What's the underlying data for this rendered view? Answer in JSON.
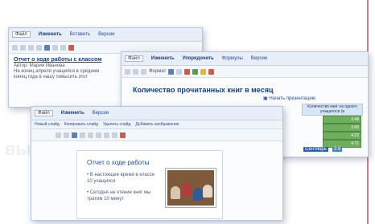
{
  "background_text": "вышенным в нашем с прошл и для моря",
  "doc_window": {
    "tabs": [
      "Файл",
      "Изменить",
      "Вставить",
      "Версии"
    ],
    "title": "Отчет о ходе работы с классом",
    "lines": [
      "Автор: Мария Иванова",
      "На конец апреля учащийся в среднем",
      "конец года в нашу повысить этот"
    ]
  },
  "spreadsheet_window": {
    "tabs": [
      "Файл",
      "Изменить",
      "Упорядочить",
      "Формулы",
      "Версии"
    ],
    "toolbar_hint": "Формат",
    "title": "Количество прочитанных книг в месяц",
    "start_presentation_label": "Начать презентацию",
    "column_header": "Количество книг на одного учащегося (в",
    "values": [
      "3.48",
      "3.60",
      "4.22",
      "4.71"
    ],
    "selected_cell": "Сентябрь",
    "badge": "3.6"
  },
  "presentation_window": {
    "tabs": [
      "Файл",
      "Изменить",
      "Версии"
    ],
    "actions": [
      "Новый слайд",
      "Копировать слайд",
      "Удалить слайд",
      "Добавить изображение"
    ],
    "slide": {
      "title": "Отчет о ходе работы",
      "bullets": [
        "В настоящее время в классе 10 учащихся",
        "Сегодня на чтение книг мы тратим 10 минут"
      ]
    }
  },
  "colors": {
    "accent": "#1e4fa0",
    "cell_green": "#6fae5c",
    "border": "#b9c6d6"
  }
}
